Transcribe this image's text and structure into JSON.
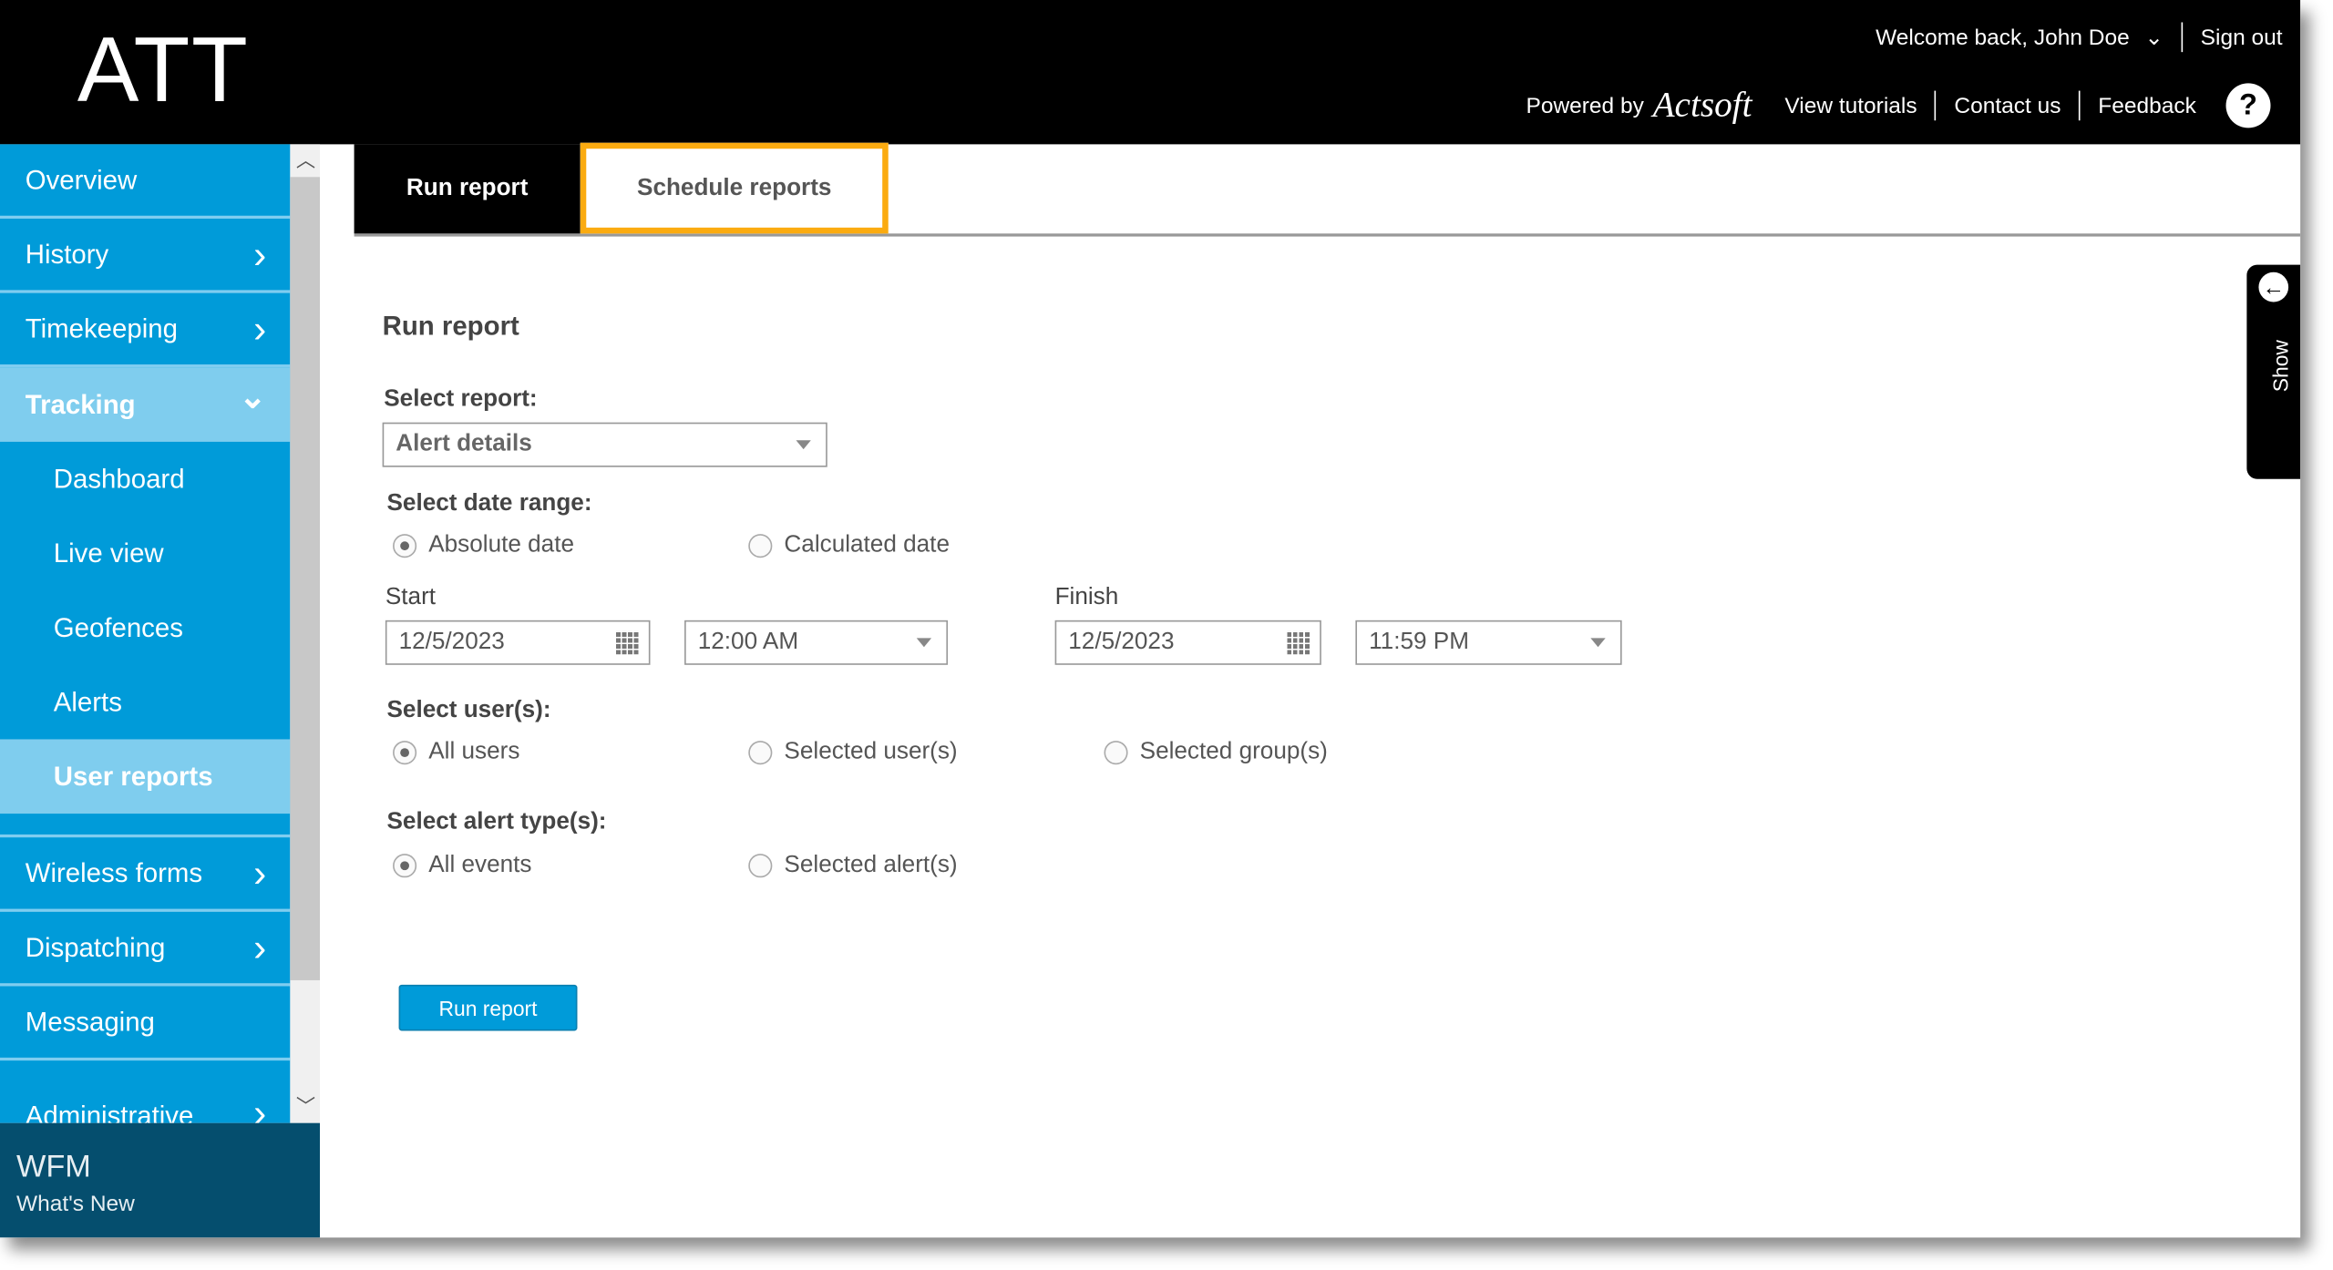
{
  "header": {
    "logo": "ATT",
    "welcome": "Welcome back, John Doe",
    "sign_out": "Sign out",
    "powered_by": "Powered by",
    "brand": "Actsoft",
    "links": [
      "View tutorials",
      "Contact us",
      "Feedback"
    ],
    "help": "?"
  },
  "sidebar": {
    "items": [
      {
        "label": "Overview"
      },
      {
        "label": "History",
        "chevron": "›"
      },
      {
        "label": "Timekeeping",
        "chevron": "›"
      },
      {
        "label": "Tracking",
        "chevron": "⌄"
      }
    ],
    "subitems": [
      "Dashboard",
      "Live view",
      "Geofences",
      "Alerts",
      "User reports"
    ],
    "items_after": [
      {
        "label": "Wireless forms",
        "chevron": "›"
      },
      {
        "label": "Dispatching",
        "chevron": "›"
      },
      {
        "label": "Messaging"
      },
      {
        "label": "Administrative",
        "chevron": "›"
      }
    ],
    "footer_title": "WFM",
    "footer_link": "What's New"
  },
  "tabs": [
    "Run report",
    "Schedule reports"
  ],
  "form": {
    "title": "Run report",
    "select_report_label": "Select report:",
    "select_report_value": "Alert details",
    "date_range_label": "Select date range:",
    "date_options": [
      "Absolute date",
      "Calculated date"
    ],
    "start_label": "Start",
    "start_date": "12/5/2023",
    "start_time": "12:00 AM",
    "finish_label": "Finish",
    "finish_date": "12/5/2023",
    "finish_time": "11:59 PM",
    "users_label": "Select user(s):",
    "user_options": [
      "All users",
      "Selected user(s)",
      "Selected group(s)"
    ],
    "alert_label": "Select alert type(s):",
    "alert_options": [
      "All events",
      "Selected alert(s)"
    ],
    "run_button": "Run report"
  },
  "side_panel": {
    "label": "Show",
    "arrow": "←"
  },
  "colors": {
    "header": "#000000",
    "sidebar": "#009bd9",
    "active": "#7fcdee",
    "highlight": "#fbab10",
    "footer": "#054e6e"
  }
}
